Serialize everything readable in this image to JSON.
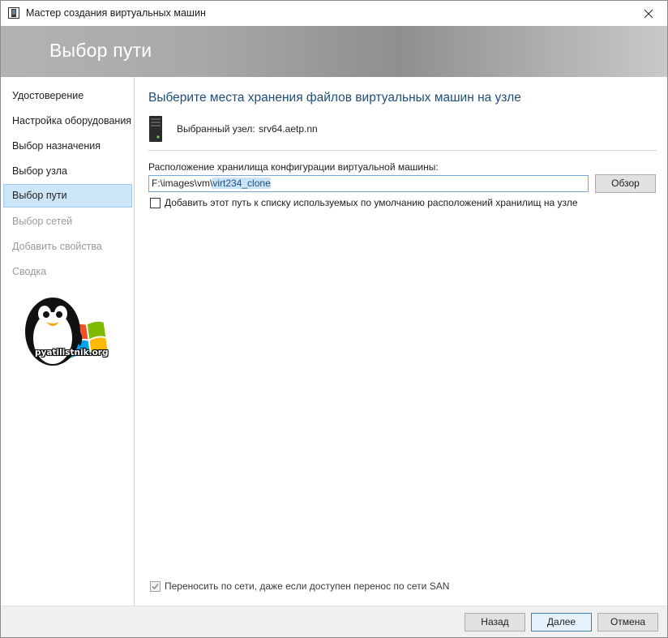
{
  "window": {
    "title": "Мастер создания виртуальных машин",
    "close_symbol": "✕"
  },
  "banner": {
    "title": "Выбор пути"
  },
  "sidebar": {
    "items": [
      {
        "label": "Удостоверение",
        "state": "normal"
      },
      {
        "label": "Настройка оборудования",
        "state": "normal"
      },
      {
        "label": "Выбор назначения",
        "state": "normal"
      },
      {
        "label": "Выбор узла",
        "state": "normal"
      },
      {
        "label": "Выбор пути",
        "state": "active"
      },
      {
        "label": "Выбор сетей",
        "state": "disabled"
      },
      {
        "label": "Добавить свойства",
        "state": "disabled"
      },
      {
        "label": "Сводка",
        "state": "disabled"
      }
    ],
    "logo_text": "pyatilistnik.org"
  },
  "main": {
    "heading": "Выберите места хранения файлов виртуальных машин на узле",
    "node_label": "Выбранный узел:",
    "node_value": "srv64.aetp.nn",
    "path_label": "Расположение хранилища конфигурации виртуальной машины:",
    "path_prefix": "F:\\images\\vm\\",
    "path_selected": "virt234_clone",
    "browse_label": "Обзор",
    "add_default_label": "Добавить этот путь к списку используемых по умолчанию расположений хранилищ на узле",
    "add_default_checked": false,
    "network_transfer_label": "Переносить по сети, даже если доступен перенос по сети SAN",
    "network_transfer_checked": true
  },
  "footer": {
    "back_label": "Назад",
    "next_label": "Далее",
    "cancel_label": "Отмена"
  },
  "colors": {
    "heading": "#1f4e79",
    "active_nav": "#cde6f7",
    "banner_text": "#ffffff",
    "disabled_text": "#9a9a9a"
  },
  "icons": {
    "app": "vm-wizard-icon",
    "server": "server-icon",
    "logo": "penguin-windows-logo"
  }
}
